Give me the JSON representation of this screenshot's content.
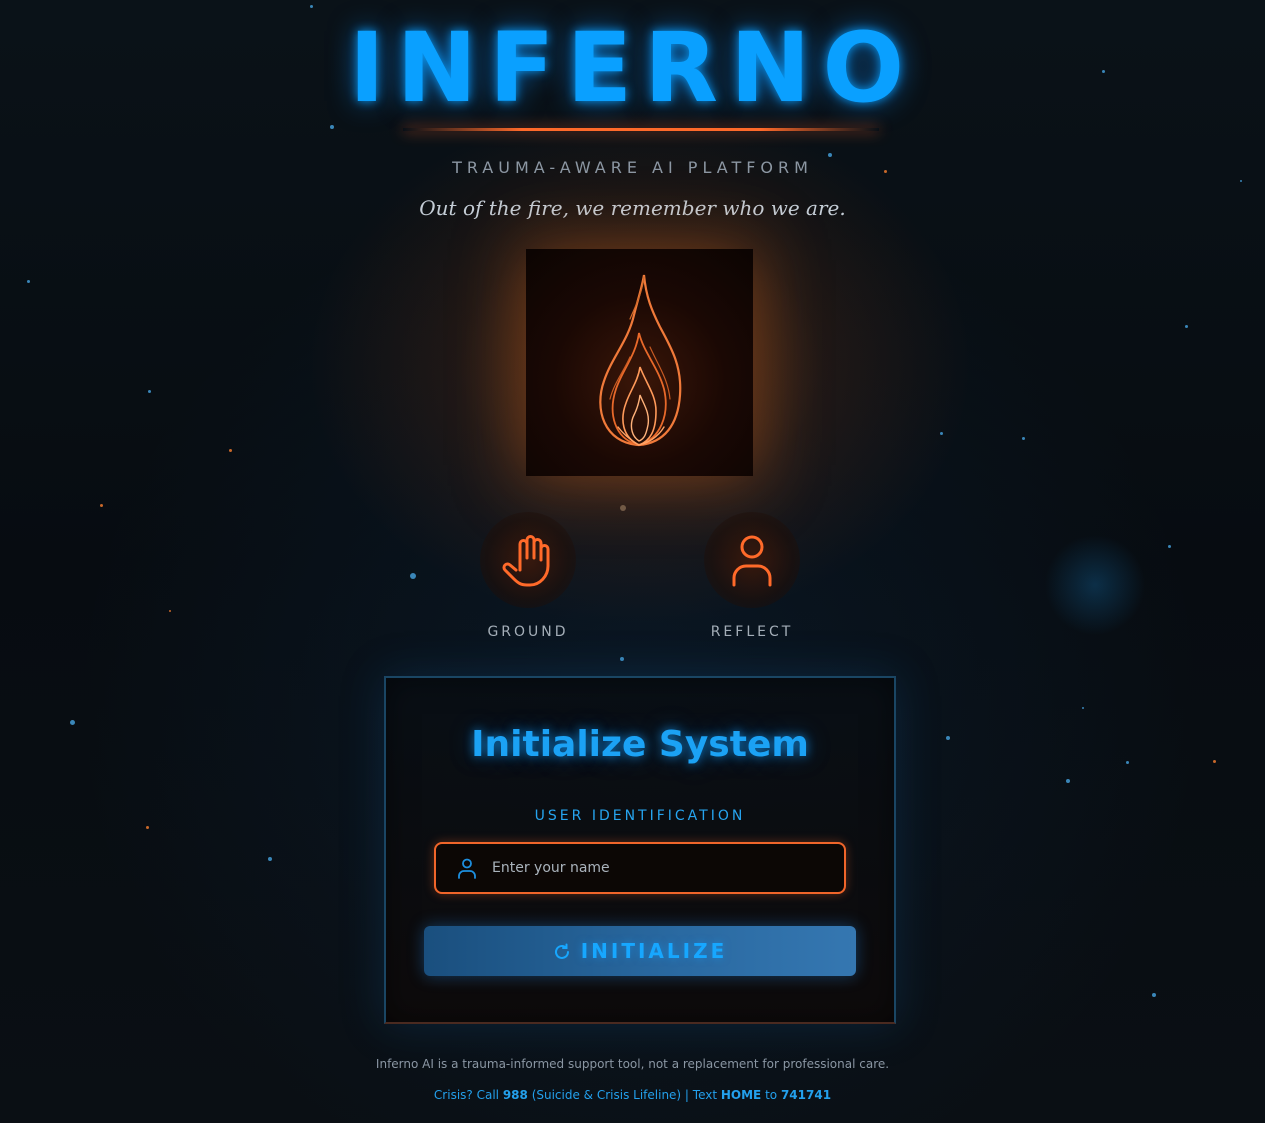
{
  "brand": {
    "title": "INFERNO",
    "subtitle": "TRAUMA-AWARE AI PLATFORM",
    "tagline": "Out of the fire, we remember who we are."
  },
  "logo": {
    "icon": "flame-icon"
  },
  "actions": [
    {
      "label": "GROUND",
      "icon": "hand-icon"
    },
    {
      "label": "REFLECT",
      "icon": "user-icon"
    }
  ],
  "login": {
    "title": "Initialize System",
    "field_label": "USER IDENTIFICATION",
    "name_placeholder": "Enter your name",
    "name_value": "",
    "button_label": "INITIALIZE",
    "button_icon": "refresh-icon"
  },
  "footer": {
    "disclaimer": "Inferno AI is a trauma-informed support tool, not a replacement for professional care.",
    "crisis_prefix": "Crisis? Call ",
    "crisis_number": "988",
    "crisis_line_name": " (Suicide & Crisis Lifeline) | Text ",
    "crisis_text_keyword": "HOME",
    "crisis_to": " to ",
    "crisis_text_number": "741741"
  },
  "colors": {
    "accent_blue": "#0aa0ff",
    "accent_orange": "#ff6a2a",
    "background": "#05080c"
  }
}
